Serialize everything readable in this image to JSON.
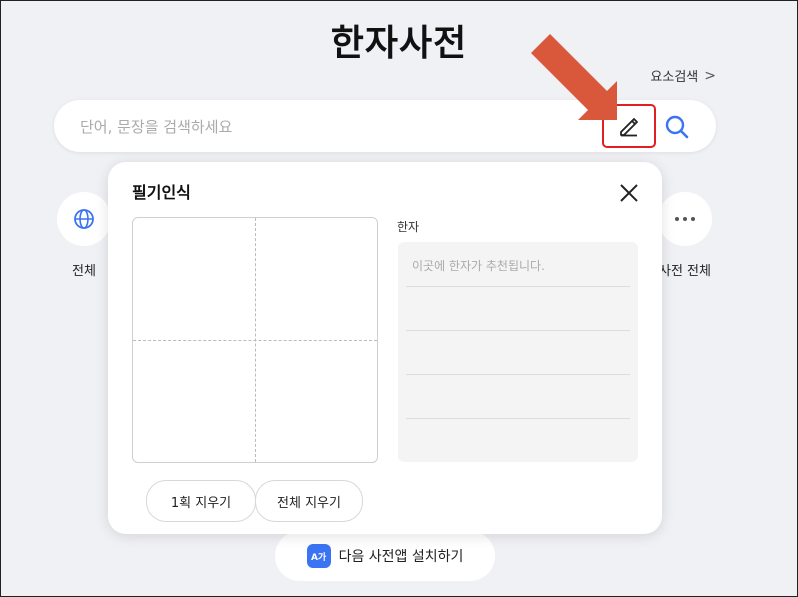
{
  "page": {
    "title": "한자사전"
  },
  "header": {
    "element_search_label": "요소검색"
  },
  "search": {
    "placeholder": "단어, 문장을 검색하세요"
  },
  "categories": [
    {
      "label": "전체",
      "icon": "globe-icon"
    },
    {
      "label": "사전 전체",
      "icon": "more-icon"
    }
  ],
  "handwriting": {
    "title": "필기인식",
    "result_label": "한자",
    "result_placeholder": "이곳에 한자가 추천됩니다.",
    "erase_stroke_label": "1획 지우기",
    "erase_all_label": "전체 지우기"
  },
  "install": {
    "icon_text": "A가",
    "label": "다음 사전앱 설치하기"
  },
  "colors": {
    "accent": "#3b74f2",
    "highlight": "#e02020",
    "arrow": "#d9573a",
    "background": "#f0f1f5"
  }
}
